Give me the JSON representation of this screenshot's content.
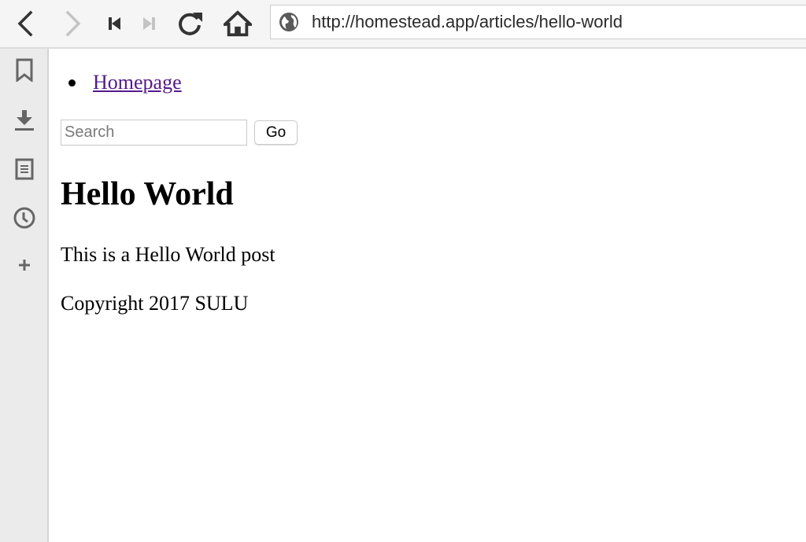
{
  "browser": {
    "url": "http://homestead.app/articles/hello-world",
    "toolbar": [
      {
        "name": "back-button",
        "icon": "chevron-left-icon",
        "enabled": true
      },
      {
        "name": "forward-button",
        "icon": "chevron-right-icon",
        "enabled": false
      },
      {
        "name": "rewind-button",
        "icon": "skip-back-icon",
        "enabled": true
      },
      {
        "name": "fast-forward-button",
        "icon": "skip-forward-icon",
        "enabled": false
      },
      {
        "name": "reload-button",
        "icon": "reload-icon",
        "enabled": true
      },
      {
        "name": "home-button",
        "icon": "home-icon",
        "enabled": true
      }
    ],
    "url_icon": "globe-icon",
    "sidebar": [
      {
        "name": "bookmarks",
        "icon": "bookmark-icon"
      },
      {
        "name": "downloads",
        "icon": "download-icon"
      },
      {
        "name": "notes",
        "icon": "notes-icon"
      },
      {
        "name": "history",
        "icon": "clock-icon"
      },
      {
        "name": "add-panel",
        "icon": "plus-icon"
      }
    ]
  },
  "page": {
    "nav": [
      {
        "label": "Homepage"
      }
    ],
    "search": {
      "placeholder": "Search",
      "value": "",
      "button_label": "Go"
    },
    "title": "Hello World",
    "body": "This is a Hello World post",
    "footer": "Copyright 2017 SULU"
  },
  "colors": {
    "link_visited": "#551a8b",
    "toolbar_bg": "#f5f5f5",
    "sidebar_bg": "#ebebeb",
    "icon_active": "#333333",
    "icon_disabled": "#c4c4c4"
  }
}
